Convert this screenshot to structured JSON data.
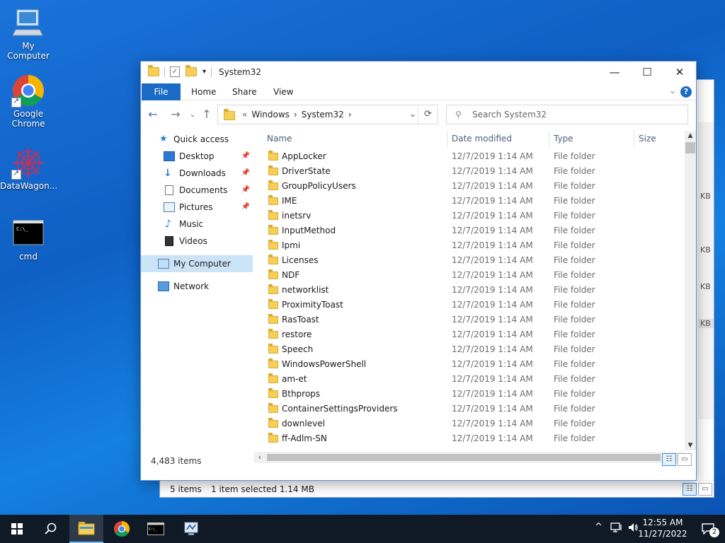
{
  "desktop": {
    "icons": [
      {
        "label": "My Computer"
      },
      {
        "label": "Google Chrome"
      },
      {
        "label": "DataWagon..."
      },
      {
        "label": "cmd"
      }
    ]
  },
  "bg_window": {
    "status_items": "5 items",
    "status_selected": "1 item selected  1.14 MB",
    "kb_labels": [
      "KB",
      "KB",
      "KB",
      "KB"
    ]
  },
  "window": {
    "title": "System32",
    "controls": {
      "minimize": "—",
      "maximize": "☐",
      "close": "✕"
    },
    "ribbon_tabs": [
      "File",
      "Home",
      "Share",
      "View"
    ],
    "help": "?",
    "address": {
      "crumbs": [
        "«",
        "Windows",
        "›",
        "System32",
        "›"
      ]
    },
    "search": {
      "placeholder": "Search System32"
    },
    "nav": [
      {
        "label": "Quick access",
        "icon": "star-icon"
      },
      {
        "label": "Desktop",
        "icon": "desktop-icon",
        "pinned": true
      },
      {
        "label": "Downloads",
        "icon": "download-icon",
        "pinned": true
      },
      {
        "label": "Documents",
        "icon": "documents-icon",
        "pinned": true
      },
      {
        "label": "Pictures",
        "icon": "pictures-icon",
        "pinned": true
      },
      {
        "label": "Music",
        "icon": "music-icon"
      },
      {
        "label": "Videos",
        "icon": "videos-icon"
      },
      {
        "label": "My Computer",
        "icon": "computer-icon",
        "selected": true
      },
      {
        "label": "Network",
        "icon": "network-icon"
      }
    ],
    "columns": [
      "Name",
      "Date modified",
      "Type",
      "Size"
    ],
    "files": [
      {
        "name": "AppLocker",
        "date": "12/7/2019 1:14 AM",
        "type": "File folder"
      },
      {
        "name": "DriverState",
        "date": "12/7/2019 1:14 AM",
        "type": "File folder"
      },
      {
        "name": "GroupPolicyUsers",
        "date": "12/7/2019 1:14 AM",
        "type": "File folder"
      },
      {
        "name": "IME",
        "date": "12/7/2019 1:14 AM",
        "type": "File folder"
      },
      {
        "name": "inetsrv",
        "date": "12/7/2019 1:14 AM",
        "type": "File folder"
      },
      {
        "name": "InputMethod",
        "date": "12/7/2019 1:14 AM",
        "type": "File folder"
      },
      {
        "name": "Ipmi",
        "date": "12/7/2019 1:14 AM",
        "type": "File folder"
      },
      {
        "name": "Licenses",
        "date": "12/7/2019 1:14 AM",
        "type": "File folder"
      },
      {
        "name": "NDF",
        "date": "12/7/2019 1:14 AM",
        "type": "File folder"
      },
      {
        "name": "networklist",
        "date": "12/7/2019 1:14 AM",
        "type": "File folder"
      },
      {
        "name": "ProximityToast",
        "date": "12/7/2019 1:14 AM",
        "type": "File folder"
      },
      {
        "name": "RasToast",
        "date": "12/7/2019 1:14 AM",
        "type": "File folder"
      },
      {
        "name": "restore",
        "date": "12/7/2019 1:14 AM",
        "type": "File folder"
      },
      {
        "name": "Speech",
        "date": "12/7/2019 1:14 AM",
        "type": "File folder"
      },
      {
        "name": "WindowsPowerShell",
        "date": "12/7/2019 1:14 AM",
        "type": "File folder"
      },
      {
        "name": "am-et",
        "date": "12/7/2019 1:14 AM",
        "type": "File folder"
      },
      {
        "name": "Bthprops",
        "date": "12/7/2019 1:14 AM",
        "type": "File folder"
      },
      {
        "name": "ContainerSettingsProviders",
        "date": "12/7/2019 1:14 AM",
        "type": "File folder"
      },
      {
        "name": "downlevel",
        "date": "12/7/2019 1:14 AM",
        "type": "File folder"
      },
      {
        "name": "ff-Adlm-SN",
        "date": "12/7/2019 1:14 AM",
        "type": "File folder"
      }
    ],
    "status_count": "4,483 items"
  },
  "taskbar": {
    "apps": [
      "start-icon",
      "search-icon",
      "file-explorer-icon",
      "chrome-icon",
      "cmd-icon",
      "network-manager-icon"
    ],
    "time": "12:55 AM",
    "date": "11/27/2022",
    "notifications": "2"
  },
  "colors": {
    "accent": "#1a6bc4",
    "selection": "#cce4f7",
    "taskbar": "#101a26"
  }
}
